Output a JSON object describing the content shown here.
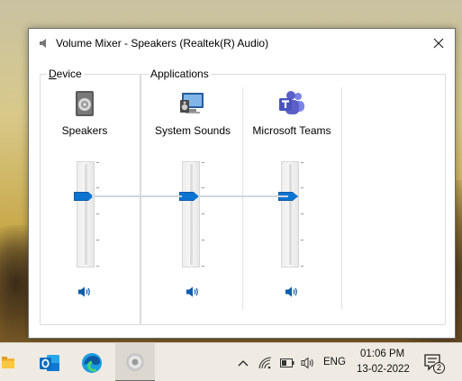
{
  "window": {
    "title": "Volume Mixer - Speakers (Realtek(R) Audio)"
  },
  "groups": {
    "device_label_first": "D",
    "device_label_rest": "evice",
    "applications_label": "Applications"
  },
  "channels": [
    {
      "name": "Speakers",
      "icon": "speaker-device-icon",
      "volume_percent": 69
    },
    {
      "name": "System Sounds",
      "icon": "system-sounds-icon",
      "volume_percent": 69
    },
    {
      "name": "Microsoft Teams",
      "icon": "microsoft-teams-icon",
      "volume_percent": 69
    }
  ],
  "taskbar": {
    "apps": [
      "file-explorer-icon",
      "outlook-icon",
      "edge-icon",
      "volume-mixer-icon"
    ],
    "tray": {
      "language": "ENG",
      "time": "01:06 PM",
      "date": "13-02-2022",
      "notification_count": "2"
    }
  },
  "colors": {
    "accent": "#0b74d1",
    "teams_purple": "#5b5fc7",
    "outlook_blue": "#0f6cbd"
  }
}
